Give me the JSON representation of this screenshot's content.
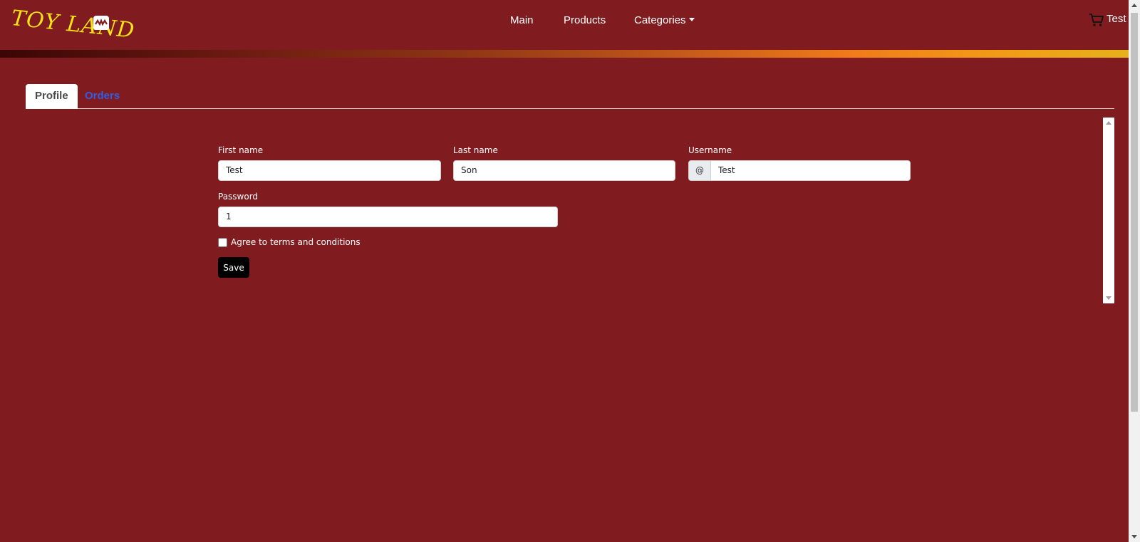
{
  "brand": {
    "logo_text": "TOY LAND"
  },
  "nav": {
    "items": [
      {
        "label": "Main"
      },
      {
        "label": "Products"
      },
      {
        "label": "Categories"
      }
    ],
    "user_label": "Test"
  },
  "tabs": [
    {
      "label": "Profile",
      "active": true
    },
    {
      "label": "Orders",
      "active": false
    }
  ],
  "form": {
    "first_name_label": "First name",
    "first_name_value": "Test",
    "last_name_label": "Last name",
    "last_name_value": "Son",
    "username_label": "Username",
    "username_prefix": "@",
    "username_value": "Test",
    "password_label": "Password",
    "password_value": "1",
    "terms_label": "Agree to terms and conditions",
    "terms_checked": false,
    "save_label": "Save"
  },
  "colors": {
    "background": "#801c1f",
    "logo": "#f6e21a",
    "tab_link": "#2f5ee8",
    "save_button": "#000000"
  },
  "icons": {
    "cart": "shopping-cart-icon",
    "dropdown": "caret-down-icon"
  }
}
